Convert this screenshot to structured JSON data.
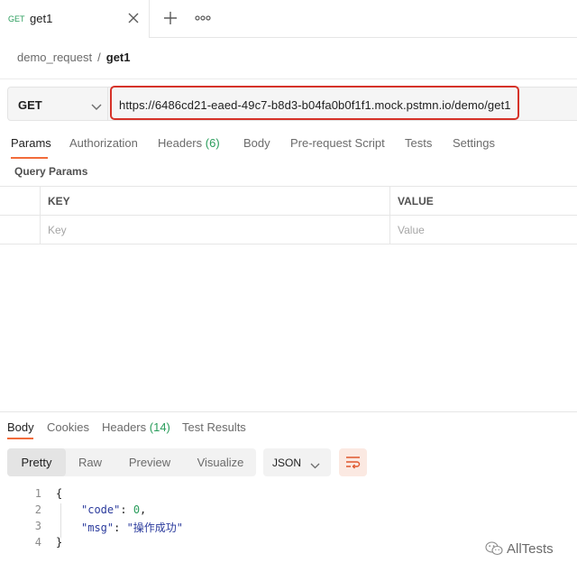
{
  "tab": {
    "method": "GET",
    "name": "get1"
  },
  "breadcrumb": {
    "collection": "demo_request",
    "separator": "/",
    "request": "get1"
  },
  "request": {
    "method": "GET",
    "url": "https://6486cd21-eaed-49c7-b8d3-b04fa0b0f1f1.mock.pstmn.io/demo/get1"
  },
  "request_tabs": {
    "params": "Params",
    "authorization": "Authorization",
    "headers": "Headers",
    "headers_count": "(6)",
    "body": "Body",
    "pre_request": "Pre-request Script",
    "tests": "Tests",
    "settings": "Settings"
  },
  "query_params": {
    "title": "Query Params",
    "key_header": "KEY",
    "value_header": "VALUE",
    "key_placeholder": "Key",
    "value_placeholder": "Value"
  },
  "response_tabs": {
    "body": "Body",
    "cookies": "Cookies",
    "headers": "Headers",
    "headers_count": "(14)",
    "test_results": "Test Results"
  },
  "view_modes": {
    "pretty": "Pretty",
    "raw": "Raw",
    "preview": "Preview",
    "visualize": "Visualize"
  },
  "format": "JSON",
  "response_body": {
    "line_numbers": [
      "1",
      "2",
      "3",
      "4"
    ],
    "open_brace": "{",
    "code_key": "\"code\"",
    "code_value": "0",
    "msg_key": "\"msg\"",
    "msg_value": "\"操作成功\"",
    "colon": ": ",
    "comma": ",",
    "close_brace": "}"
  },
  "watermark": "AllTests",
  "colors": {
    "accent": "#f26b3a",
    "get": "#2a9d5c",
    "highlight": "#d63228"
  },
  "icons": [
    "close-icon",
    "plus-icon",
    "more-icon",
    "chevron-down-icon",
    "wrap-lines-icon",
    "wechat-icon"
  ]
}
